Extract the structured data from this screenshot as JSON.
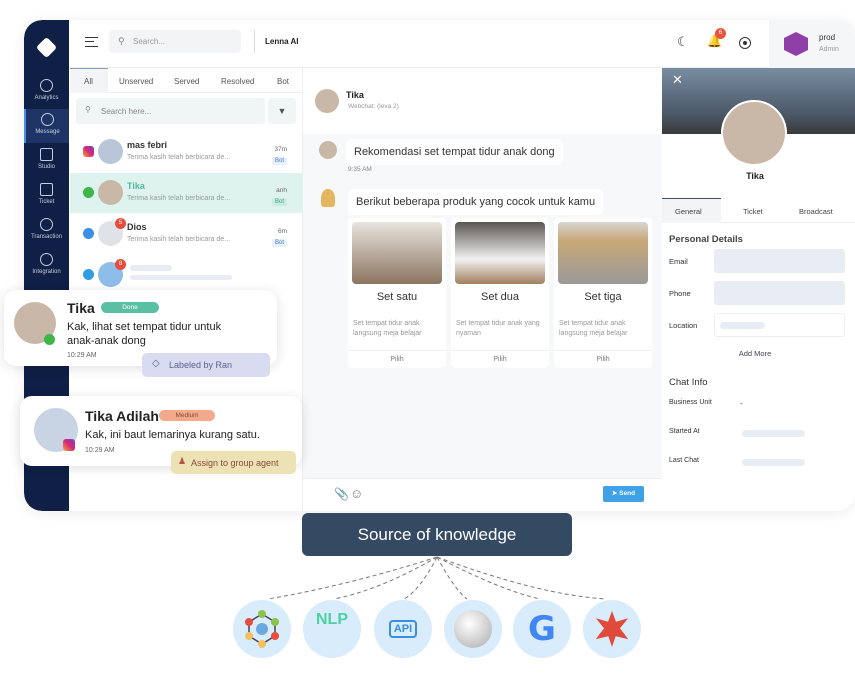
{
  "sidebar": {
    "items": [
      {
        "label": "Analytics"
      },
      {
        "label": "Message"
      },
      {
        "label": "Studio"
      },
      {
        "label": "Ticket"
      },
      {
        "label": "Transaction"
      },
      {
        "label": "Integration"
      }
    ]
  },
  "header": {
    "search_placeholder": "Search...",
    "workspace": "Lenna AI",
    "notification_count": "6",
    "user_name": "prod",
    "user_role": "Admin"
  },
  "list": {
    "tabs": [
      "All",
      "Unserved",
      "Served",
      "Resolved",
      "Bot"
    ],
    "search_placeholder": "Search here...",
    "items": [
      {
        "name": "mas febri",
        "preview": "Terima kasih telah berbicara de...",
        "time": "37m",
        "tag": "Bot",
        "channel": "instagram"
      },
      {
        "name": "Tika",
        "preview": "Terima kasih telah berbicara de...",
        "time": "anh",
        "tag": "Bot",
        "channel": "whatsapp"
      },
      {
        "name": "Dios",
        "preview": "Terima kasih telah berbicara de...",
        "time": "6m",
        "tag": "Bot",
        "channel": "messenger",
        "badge": "5"
      },
      {
        "badge": "8",
        "channel": "telegram"
      }
    ]
  },
  "chat": {
    "contact": "Tika",
    "sub": "Webchat: (leva 2)",
    "messages": [
      {
        "text": "Rekomendasi set tempat tidur anak dong",
        "time": "9:35 AM"
      },
      {
        "text": "Berikut beberapa produk yang cocok untuk kamu"
      }
    ],
    "products": [
      {
        "title": "Set satu",
        "desc": "Set tempat tidur anak langsung meja belajar",
        "action": "Pilih"
      },
      {
        "title": "Set dua",
        "desc": "Set tempat tidur anak yang nyaman",
        "action": "Pilih"
      },
      {
        "title": "Set tiga",
        "desc": "Set tempat tidur anak langsung meja belajar",
        "action": "Pilih"
      }
    ],
    "send": "Send"
  },
  "profile": {
    "name": "Tika",
    "tabs": [
      "General",
      "Ticket",
      "Broadcast"
    ],
    "personal_title": "Personal Details",
    "fields": [
      "Email",
      "Phone",
      "Location"
    ],
    "add_more": "Add More",
    "chat_info_title": "Chat Info",
    "business_unit": "Business Unit",
    "business_unit_value": "-",
    "started_at": "Started At",
    "last_chat": "Last Chat"
  },
  "cards": [
    {
      "name": "Tika",
      "status": "Done",
      "message": "Kak, lihat set tempat tidur untuk anak-anak dong",
      "time": "10:29 AM",
      "label": "Labeled by Ran"
    },
    {
      "name": "Tika Adilah",
      "status": "Medium",
      "message": "Kak, ini baut lemarinya kurang satu.",
      "time": "10:29 AM",
      "label": "Assign to group agent"
    }
  ],
  "knowledge": {
    "title": "Source of knowledge",
    "sources": [
      {
        "icon": "knowledge-graph-icon"
      },
      {
        "icon": "nlp-icon",
        "text": "NLP"
      },
      {
        "icon": "api-icon",
        "text": "API"
      },
      {
        "icon": "wikipedia-icon"
      },
      {
        "icon": "google-icon"
      },
      {
        "icon": "wolfram-icon"
      }
    ]
  },
  "colors": {
    "sidebar": "#0f1f45",
    "accent": "#4fb8a0",
    "selected_row": "#dff3ee",
    "knowledge_box": "#344a63",
    "send": "#3fa2e8"
  }
}
